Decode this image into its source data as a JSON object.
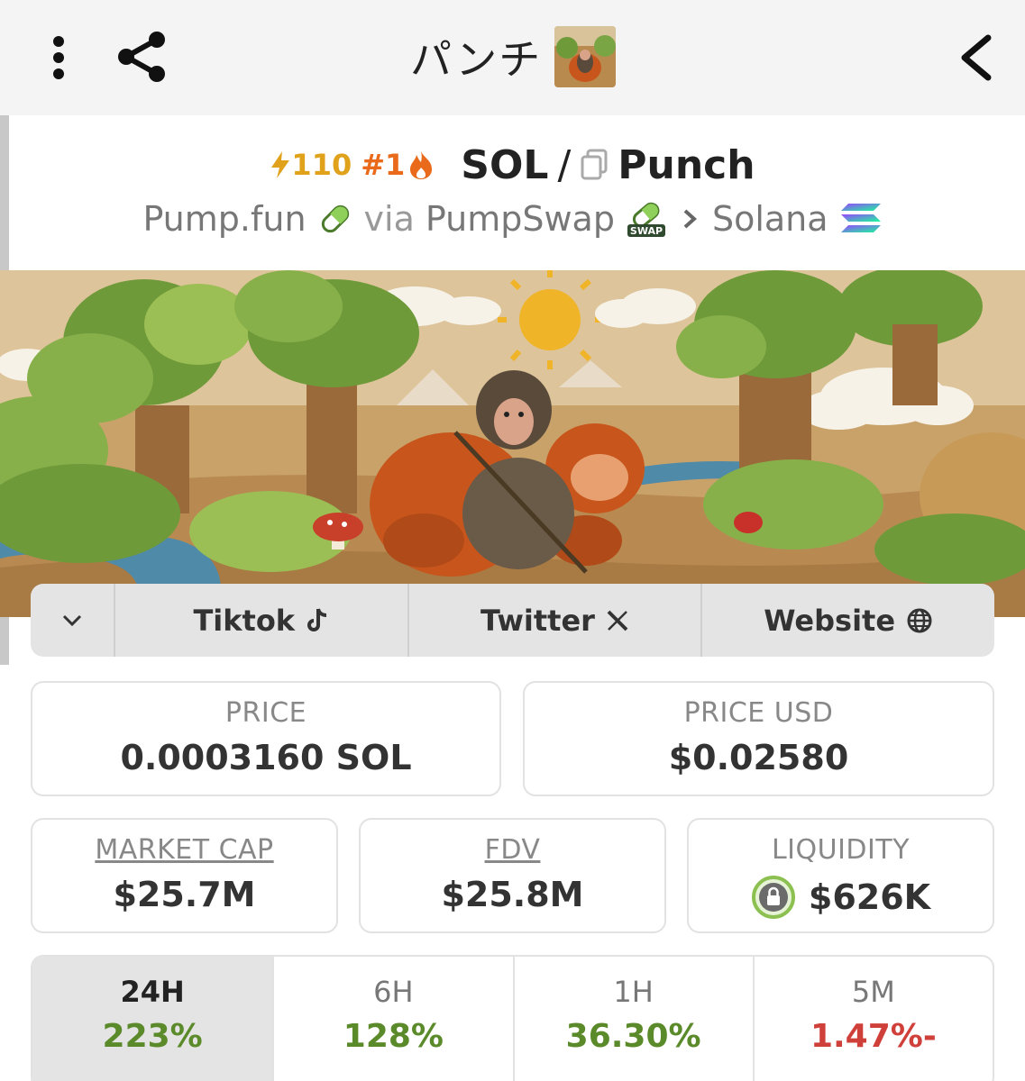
{
  "header": {
    "title": "パンチ",
    "menu_icon": "vertical-dots-icon",
    "share_icon": "share-icon",
    "back_icon": "chevron-left-icon"
  },
  "pair": {
    "boost": "110",
    "rank": "#1",
    "base": "SOL",
    "separator": "/",
    "quote": "Punch"
  },
  "route": {
    "dex": "Pump.fun",
    "via": "via",
    "swap": "PumpSwap",
    "swap_badge": "SWAP",
    "chain": "Solana"
  },
  "links": {
    "expand_icon": "chevron-down-icon",
    "tiktok": "Tiktok",
    "twitter": "Twitter",
    "website": "Website"
  },
  "stats": {
    "price_label": "PRICE",
    "price_value": "0.0003160 SOL",
    "price_usd_label": "PRICE USD",
    "price_usd_value": "$0.02580",
    "mcap_label": "MARKET CAP",
    "mcap_value": "$25.7M",
    "fdv_label": "FDV",
    "fdv_value": "$25.8M",
    "liq_label": "LIQUIDITY",
    "liq_value": "$626K"
  },
  "changes": [
    {
      "period": "24H",
      "pct": "223%",
      "color": "#5b8a2a"
    },
    {
      "period": "6H",
      "pct": "128%",
      "color": "#5b8a2a"
    },
    {
      "period": "1H",
      "pct": "36.30%",
      "color": "#5b8a2a"
    },
    {
      "period": "5M",
      "pct": "1.47%-",
      "color": "#d0403a"
    }
  ],
  "colors": {
    "boost": "#e0a21a",
    "rank": "#e86a1a",
    "positive": "#5b8a2a",
    "negative": "#d0403a"
  }
}
